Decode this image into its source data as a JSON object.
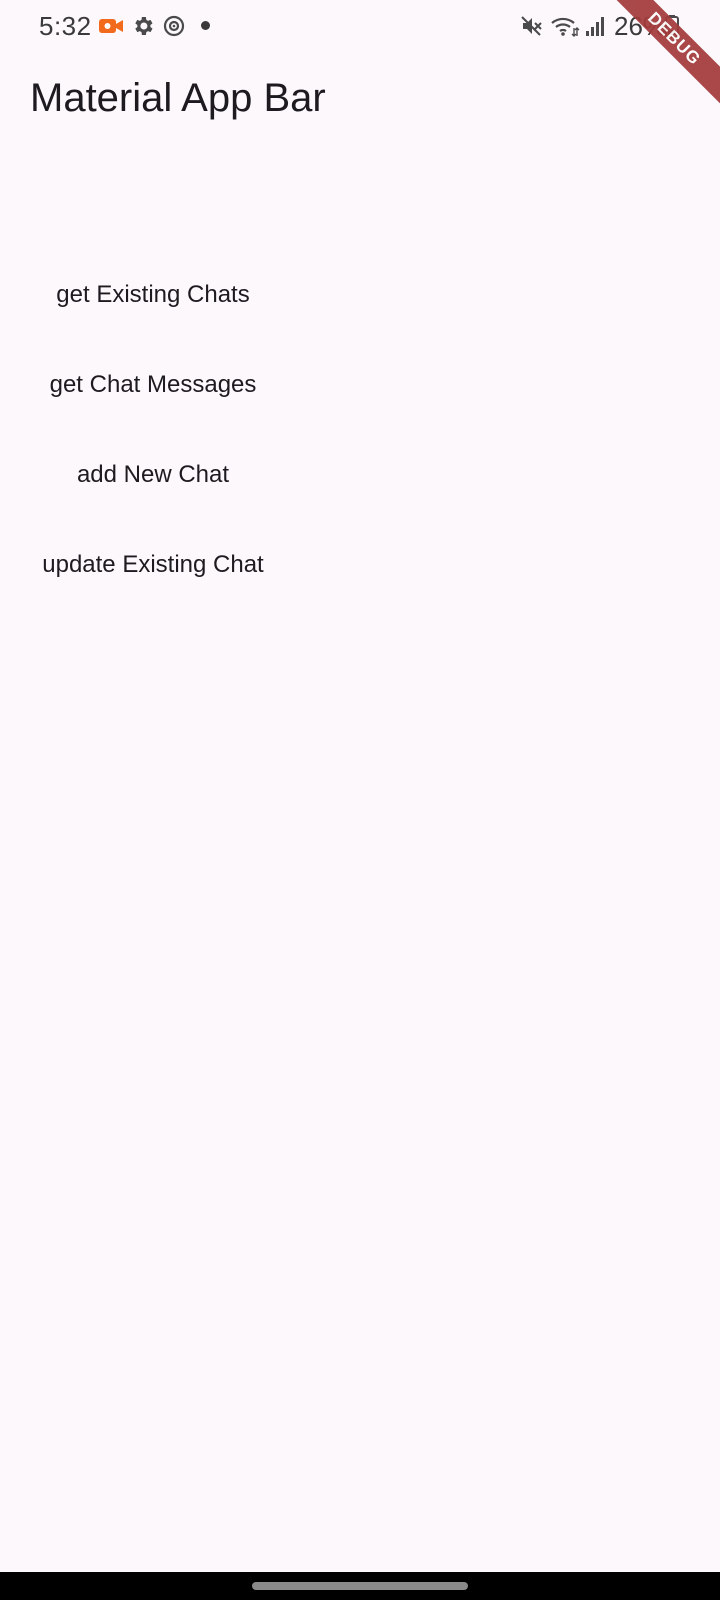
{
  "status_bar": {
    "time": "5:32",
    "battery": "26%",
    "icons": [
      "screen-record-icon",
      "settings-gear-icon",
      "focus-mode-icon",
      "notification-dot-icon",
      "mute-icon",
      "wifi-icon",
      "signal-icon",
      "battery-icon"
    ],
    "record_color": "#f26a1b"
  },
  "debug_banner": "DEBUG",
  "app_bar": {
    "title": "Material App Bar"
  },
  "buttons": [
    {
      "label": "get Existing Chats"
    },
    {
      "label": "get Chat Messages"
    },
    {
      "label": "add New Chat"
    },
    {
      "label": "update Existing Chat"
    }
  ],
  "colors": {
    "background": "#fdf8fc",
    "debug_ribbon": "#a33a3a"
  }
}
